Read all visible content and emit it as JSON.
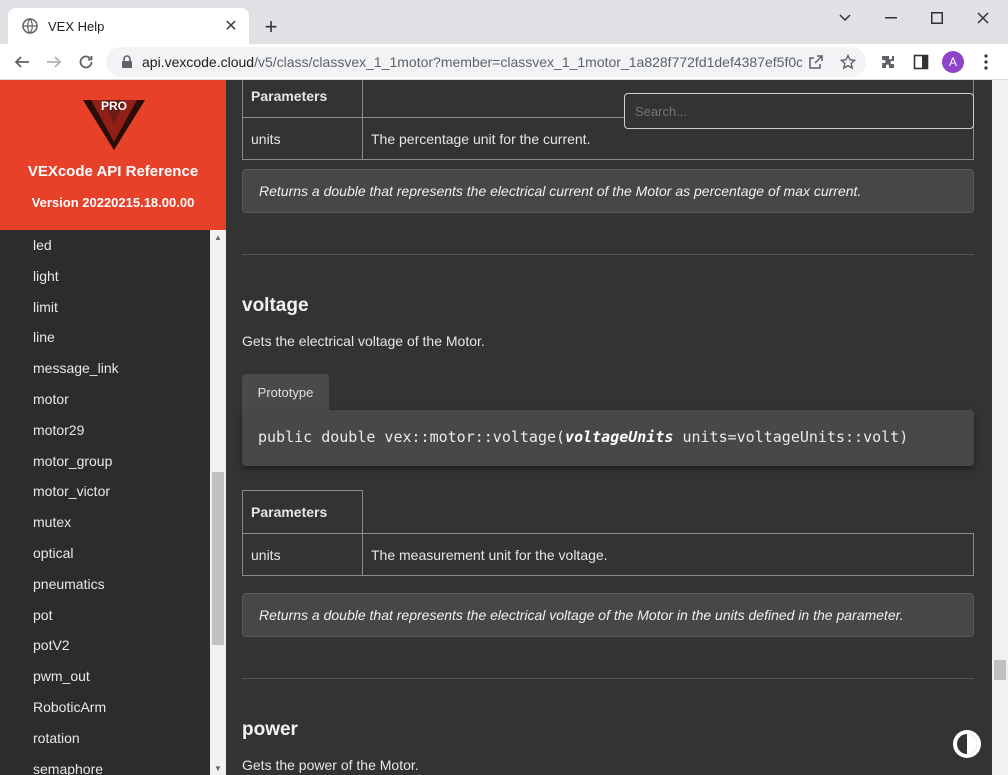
{
  "browser": {
    "tab_title": "VEX Help",
    "tab_close": "✕",
    "new_tab": "+",
    "url_host": "api.vexcode.cloud",
    "url_path": "/v5/class/classvex_1_1motor?member=classvex_1_1motor_1a828f772fd1def4387ef5f0c...",
    "avatar_letter": "A"
  },
  "sidebar": {
    "title": "VEXcode API Reference",
    "version": "Version 20220215.18.00.00",
    "logo_text": "PRO",
    "items": [
      "led",
      "light",
      "limit",
      "line",
      "message_link",
      "motor",
      "motor29",
      "motor_group",
      "motor_victor",
      "mutex",
      "optical",
      "pneumatics",
      "pot",
      "potV2",
      "pwm_out",
      "RoboticArm",
      "rotation",
      "semaphore"
    ]
  },
  "search": {
    "placeholder": "Search..."
  },
  "top_section": {
    "params_header": "Parameters",
    "param_name": "units",
    "param_desc": "The percentage unit for the current.",
    "returns": "Returns a double that represents the electrical current of the Motor as percentage of max current."
  },
  "voltage_section": {
    "title": "voltage",
    "description": "Gets the electrical voltage of the Motor.",
    "prototype_tab": "Prototype",
    "code_prefix": "public double vex::motor::voltage(",
    "code_type": "voltageUnits",
    "code_suffix": " units=voltageUnits::volt)",
    "params_header": "Parameters",
    "param_name": "units",
    "param_desc": "The measurement unit for the voltage.",
    "returns": "Returns a double that represents the electrical voltage of the Motor in the units defined in the parameter."
  },
  "power_section": {
    "title": "power",
    "description": "Gets the power of the Motor."
  },
  "colors": {
    "brand": "#e8412a",
    "background": "#333333",
    "sidebar_bg": "#2c2c2c"
  }
}
